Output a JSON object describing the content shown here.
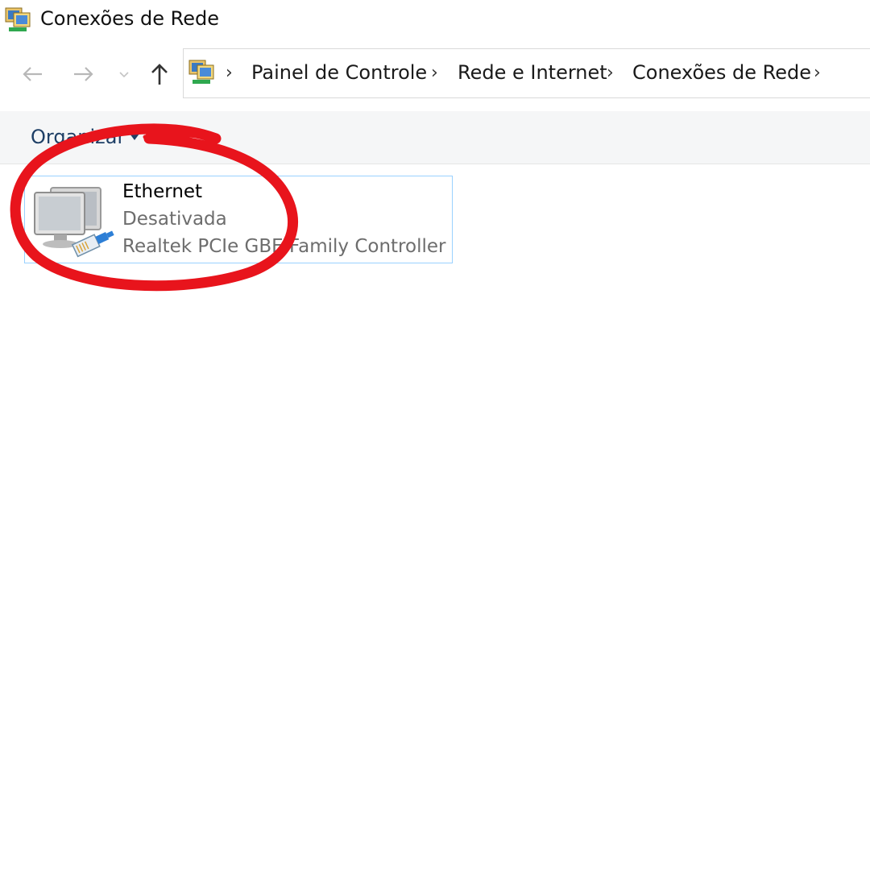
{
  "window": {
    "title": "Conexões de Rede",
    "icon": "network-connections-icon"
  },
  "nav": {
    "back_icon": "arrow-left-icon",
    "forward_icon": "arrow-right-icon",
    "recent_icon": "chevron-down-icon",
    "up_icon": "arrow-up-icon"
  },
  "address_bar": {
    "breadcrumbs": [
      {
        "label": "Painel de Controle"
      },
      {
        "label": "Rede e Internet"
      },
      {
        "label": "Conexões de Rede"
      }
    ]
  },
  "toolbar": {
    "organize_label": "Organizar"
  },
  "connections": [
    {
      "name": "Ethernet",
      "status": "Desativada",
      "device": "Realtek PCIe GBE Family Controller",
      "icon": "ethernet-adapter-icon"
    }
  ],
  "colors": {
    "selection_border": "#99d1ff",
    "annotation_red": "#e8141c",
    "toolbar_bg": "#f5f6f7",
    "organize_text": "#1e3f66"
  }
}
